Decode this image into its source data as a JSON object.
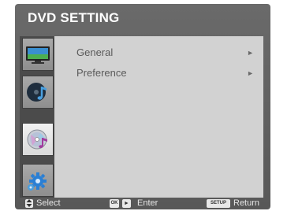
{
  "title": "DVD SETTING",
  "sidebar": {
    "tabs": [
      {
        "icon": "tv-icon",
        "active": false
      },
      {
        "icon": "music-note-disc-icon",
        "active": false
      },
      {
        "icon": "music-cd-icon",
        "active": true
      },
      {
        "icon": "gear-icon",
        "active": false
      }
    ]
  },
  "menu": {
    "items": [
      {
        "label": "General",
        "arrow": "►"
      },
      {
        "label": "Preference",
        "arrow": "►"
      }
    ]
  },
  "footer": {
    "select_label": "Select",
    "ok_key": "OK",
    "right_key": "►",
    "enter_label": "Enter",
    "setup_key": "SETUP",
    "return_label": "Return"
  },
  "colors": {
    "frame": "#606060",
    "panel": "#d2d2d2",
    "active_tab": "#eeeeee"
  }
}
